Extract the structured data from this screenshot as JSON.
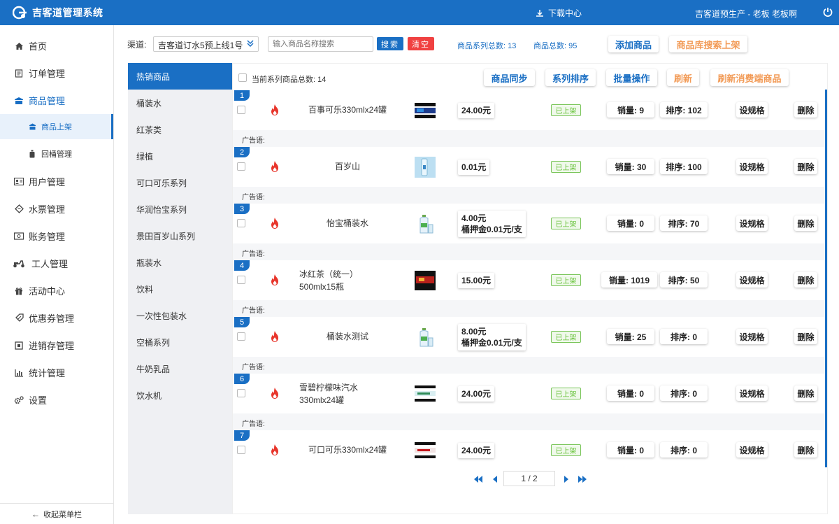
{
  "app": {
    "title": "吉客道管理系统",
    "download_label": "下载中心",
    "user_label": "吉客道预生产 - 老板  老板啊"
  },
  "sidebar": {
    "items": [
      {
        "label": "首页",
        "icon": "home-icon"
      },
      {
        "label": "订单管理",
        "icon": "order-icon"
      },
      {
        "label": "商品管理",
        "icon": "goods-icon"
      },
      {
        "label": "用户管理",
        "icon": "user-card-icon"
      },
      {
        "label": "水票管理",
        "icon": "ticket-icon"
      },
      {
        "label": "账务管理",
        "icon": "account-icon"
      },
      {
        "label": "工人管理",
        "icon": "scooter-icon"
      },
      {
        "label": "活动中心",
        "icon": "gift-icon"
      },
      {
        "label": "优惠券管理",
        "icon": "coupon-icon"
      },
      {
        "label": "进销存管理",
        "icon": "inventory-icon"
      },
      {
        "label": "统计管理",
        "icon": "chart-icon"
      },
      {
        "label": "设置",
        "icon": "settings-icon"
      }
    ],
    "sub_items": [
      {
        "label": "商品上架",
        "icon": "shop-icon"
      },
      {
        "label": "回桶管理",
        "icon": "bucket-icon"
      }
    ],
    "collapse_label": "收起菜单栏"
  },
  "filter": {
    "channel_label": "渠道:",
    "channel_value": "吉客道订水5预上线1号",
    "search_placeholder": "输入商品名称搜索",
    "search_button": "搜索",
    "clear_button": "清空",
    "series_total": "商品系列总数: 13",
    "goods_total": "商品总数: 95",
    "add_button": "添加商品",
    "library_button": "商品库搜索上架"
  },
  "categories": [
    "热销商品",
    "桶装水",
    "红茶类",
    "绿植",
    "可口可乐系列",
    "华润怡宝系列",
    "景田百岁山系列",
    "瓶装水",
    "饮料",
    "一次性包装水",
    "空桶系列",
    "牛奶乳品",
    "饮水机"
  ],
  "list_header": {
    "count_label": "当前系列商品总数: 14",
    "actions": [
      "商品同步",
      "系列排序",
      "批量操作",
      "刷新",
      "刷新消费端商品"
    ]
  },
  "products": [
    {
      "index": "1",
      "name": [
        "百事可乐330mlx24罐"
      ],
      "price": [
        "24.00元"
      ],
      "status": "已上架",
      "sales": "销量: 9",
      "sort": "排序: 102",
      "thumb": "cola-can",
      "ad_label": "广告语:"
    },
    {
      "index": "2",
      "name": [
        "百岁山"
      ],
      "price": [
        "0.01元"
      ],
      "status": "已上架",
      "sales": "销量: 30",
      "sort": "排序: 100",
      "thumb": "mineral-water",
      "ad_label": "广告语:"
    },
    {
      "index": "3",
      "name": [
        "怡宝桶装水"
      ],
      "price": [
        "4.00元",
        "桶押金0.01元/支"
      ],
      "status": "已上架",
      "sales": "销量: 0",
      "sort": "排序: 70",
      "thumb": "water-bottle",
      "ad_label": "广告语:"
    },
    {
      "index": "4",
      "name": [
        "冰红茶（统一）",
        "500mlx15瓶"
      ],
      "price": [
        "15.00元"
      ],
      "status": "已上架",
      "sales": "销量: 1019",
      "sort": "排序: 50",
      "thumb": "tea-box",
      "ad_label": "广告语:"
    },
    {
      "index": "5",
      "name": [
        "桶装水测试"
      ],
      "price": [
        "8.00元",
        "桶押金0.01元/支"
      ],
      "status": "已上架",
      "sales": "销量: 25",
      "sort": "排序: 0",
      "thumb": "water-bottle",
      "ad_label": "广告语:"
    },
    {
      "index": "6",
      "name": [
        "雪碧柠檬味汽水",
        "330mlx24罐"
      ],
      "price": [
        "24.00元"
      ],
      "status": "已上架",
      "sales": "销量: 0",
      "sort": "排序: 0",
      "thumb": "sprite-can",
      "ad_label": "广告语:"
    },
    {
      "index": "7",
      "name": [
        "可口可乐330mlx24罐"
      ],
      "price": [
        "24.00元"
      ],
      "status": "已上架",
      "sales": "销量: 0",
      "sort": "排序: 0",
      "thumb": "coke-can",
      "ad_label": ""
    }
  ],
  "row_actions": {
    "spec": "设规格",
    "delete": "删除"
  },
  "pager": {
    "text": "1 / 2"
  },
  "colors": {
    "primary": "#1a6fc4",
    "danger": "#f04141",
    "orange": "#f29b57",
    "success": "#67c23a",
    "fire": "#e8352b"
  }
}
